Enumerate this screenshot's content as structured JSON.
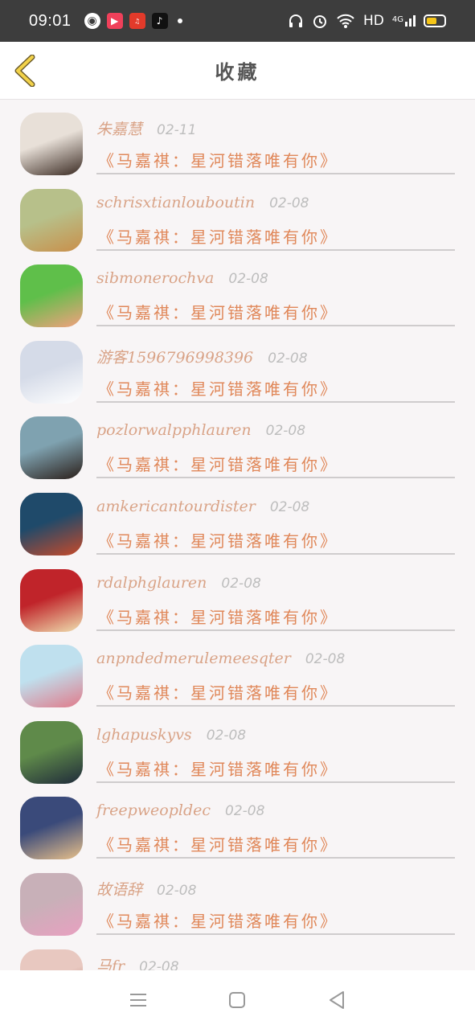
{
  "status_bar": {
    "time": "09:01",
    "network": "HD",
    "signal": "4G",
    "battery_level": 0.6
  },
  "header": {
    "title": "收藏"
  },
  "favorites": [
    {
      "name": "朱嘉慧",
      "date": "02-11",
      "title": "《马嘉祺：星河错落唯有你》",
      "avatar_colors": [
        "#e8e0d8",
        "#3a2a22"
      ]
    },
    {
      "name": "schrisxtianlouboutin",
      "date": "02-08",
      "title": "《马嘉祺：星河错落唯有你》",
      "avatar_colors": [
        "#b7c08a",
        "#c98f4a"
      ]
    },
    {
      "name": "sibmonerochva",
      "date": "02-08",
      "title": "《马嘉祺：星河错落唯有你》",
      "avatar_colors": [
        "#5fbf4a",
        "#f3a07e"
      ]
    },
    {
      "name": "游客1596796998396",
      "date": "02-08",
      "title": "《马嘉祺：星河错落唯有你》",
      "avatar_colors": [
        "#d5dbe8",
        "#ffffff"
      ]
    },
    {
      "name": "pozlorwalpphlauren",
      "date": "02-08",
      "title": "《马嘉祺：星河错落唯有你》",
      "avatar_colors": [
        "#7fa2b0",
        "#2b1f1a"
      ]
    },
    {
      "name": "amkericantourdister",
      "date": "02-08",
      "title": "《马嘉祺：星河错落唯有你》",
      "avatar_colors": [
        "#1f4a6a",
        "#c84a2a"
      ]
    },
    {
      "name": "rdalphglauren",
      "date": "02-08",
      "title": "《马嘉祺：星河错落唯有你》",
      "avatar_colors": [
        "#c0242a",
        "#efe0b0"
      ]
    },
    {
      "name": "anpndedmerulemeesqter",
      "date": "02-08",
      "title": "《马嘉祺：星河错落唯有你》",
      "avatar_colors": [
        "#bfe0ee",
        "#e07a8a"
      ]
    },
    {
      "name": "lghapuskyvs",
      "date": "02-08",
      "title": "《马嘉祺：星河错落唯有你》",
      "avatar_colors": [
        "#5f8a4a",
        "#1f2a3a"
      ]
    },
    {
      "name": "freepweopldec",
      "date": "02-08",
      "title": "《马嘉祺：星河错落唯有你》",
      "avatar_colors": [
        "#3a4a7a",
        "#e8c08a"
      ]
    },
    {
      "name": "故语辞",
      "date": "02-08",
      "title": "《马嘉祺：星河错落唯有你》",
      "avatar_colors": [
        "#c8b0b8",
        "#e8a0c0"
      ]
    },
    {
      "name": "马fr",
      "date": "02-08",
      "title": "",
      "avatar_colors": [
        "#e8c8c0",
        "#9a5a4a"
      ]
    }
  ]
}
